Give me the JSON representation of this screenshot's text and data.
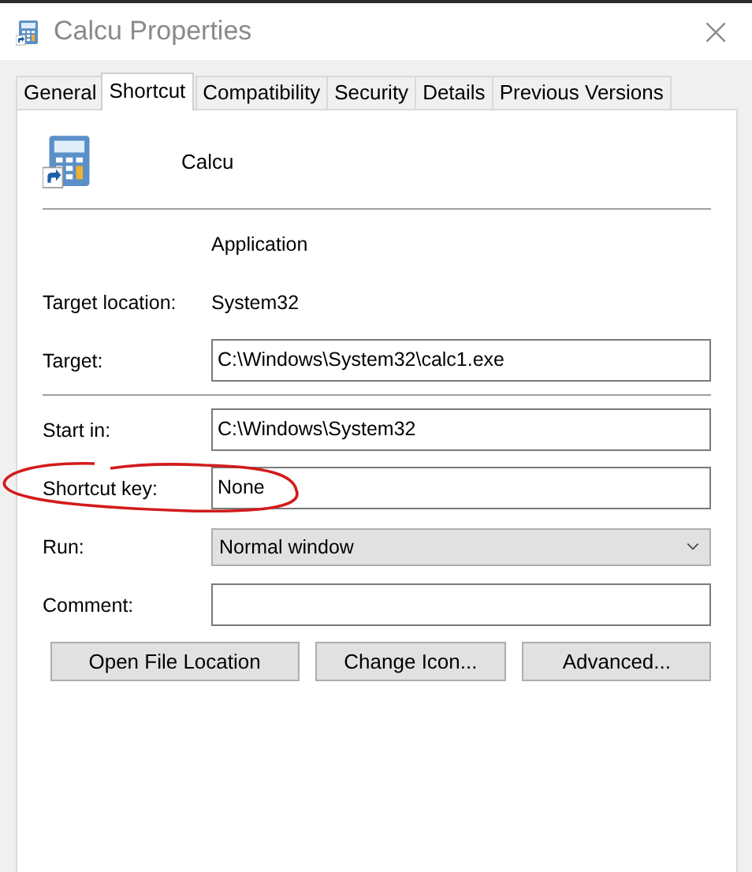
{
  "window": {
    "title": "Calcu Properties",
    "close": "×"
  },
  "tabs": [
    {
      "label": "General",
      "selected": false
    },
    {
      "label": "Shortcut",
      "selected": true
    },
    {
      "label": "Compatibility",
      "selected": false
    },
    {
      "label": "Security",
      "selected": false
    },
    {
      "label": "Details",
      "selected": false
    },
    {
      "label": "Previous Versions",
      "selected": false
    }
  ],
  "header": {
    "name": "Calcu"
  },
  "sections": [
    {
      "rows": [
        {
          "kind": "text",
          "value": "Application"
        },
        {
          "kind": "text",
          "label": "Target location:",
          "value": "System32"
        },
        {
          "kind": "field",
          "label": "Target:",
          "value": "C:\\Windows\\System32\\calc1.exe"
        }
      ]
    },
    {
      "rows": [
        {
          "kind": "field",
          "label": "Start in:",
          "value": "C:\\Windows\\System32"
        },
        {
          "kind": "field",
          "label": "Shortcut key:",
          "value": "None",
          "circled": true
        },
        {
          "kind": "dropdown",
          "label": "Run:",
          "value": "Normal window"
        },
        {
          "kind": "field",
          "label": "Comment:"
        }
      ]
    }
  ],
  "buttons": [
    "Open File Location",
    "Change Icon...",
    "Advanced..."
  ]
}
